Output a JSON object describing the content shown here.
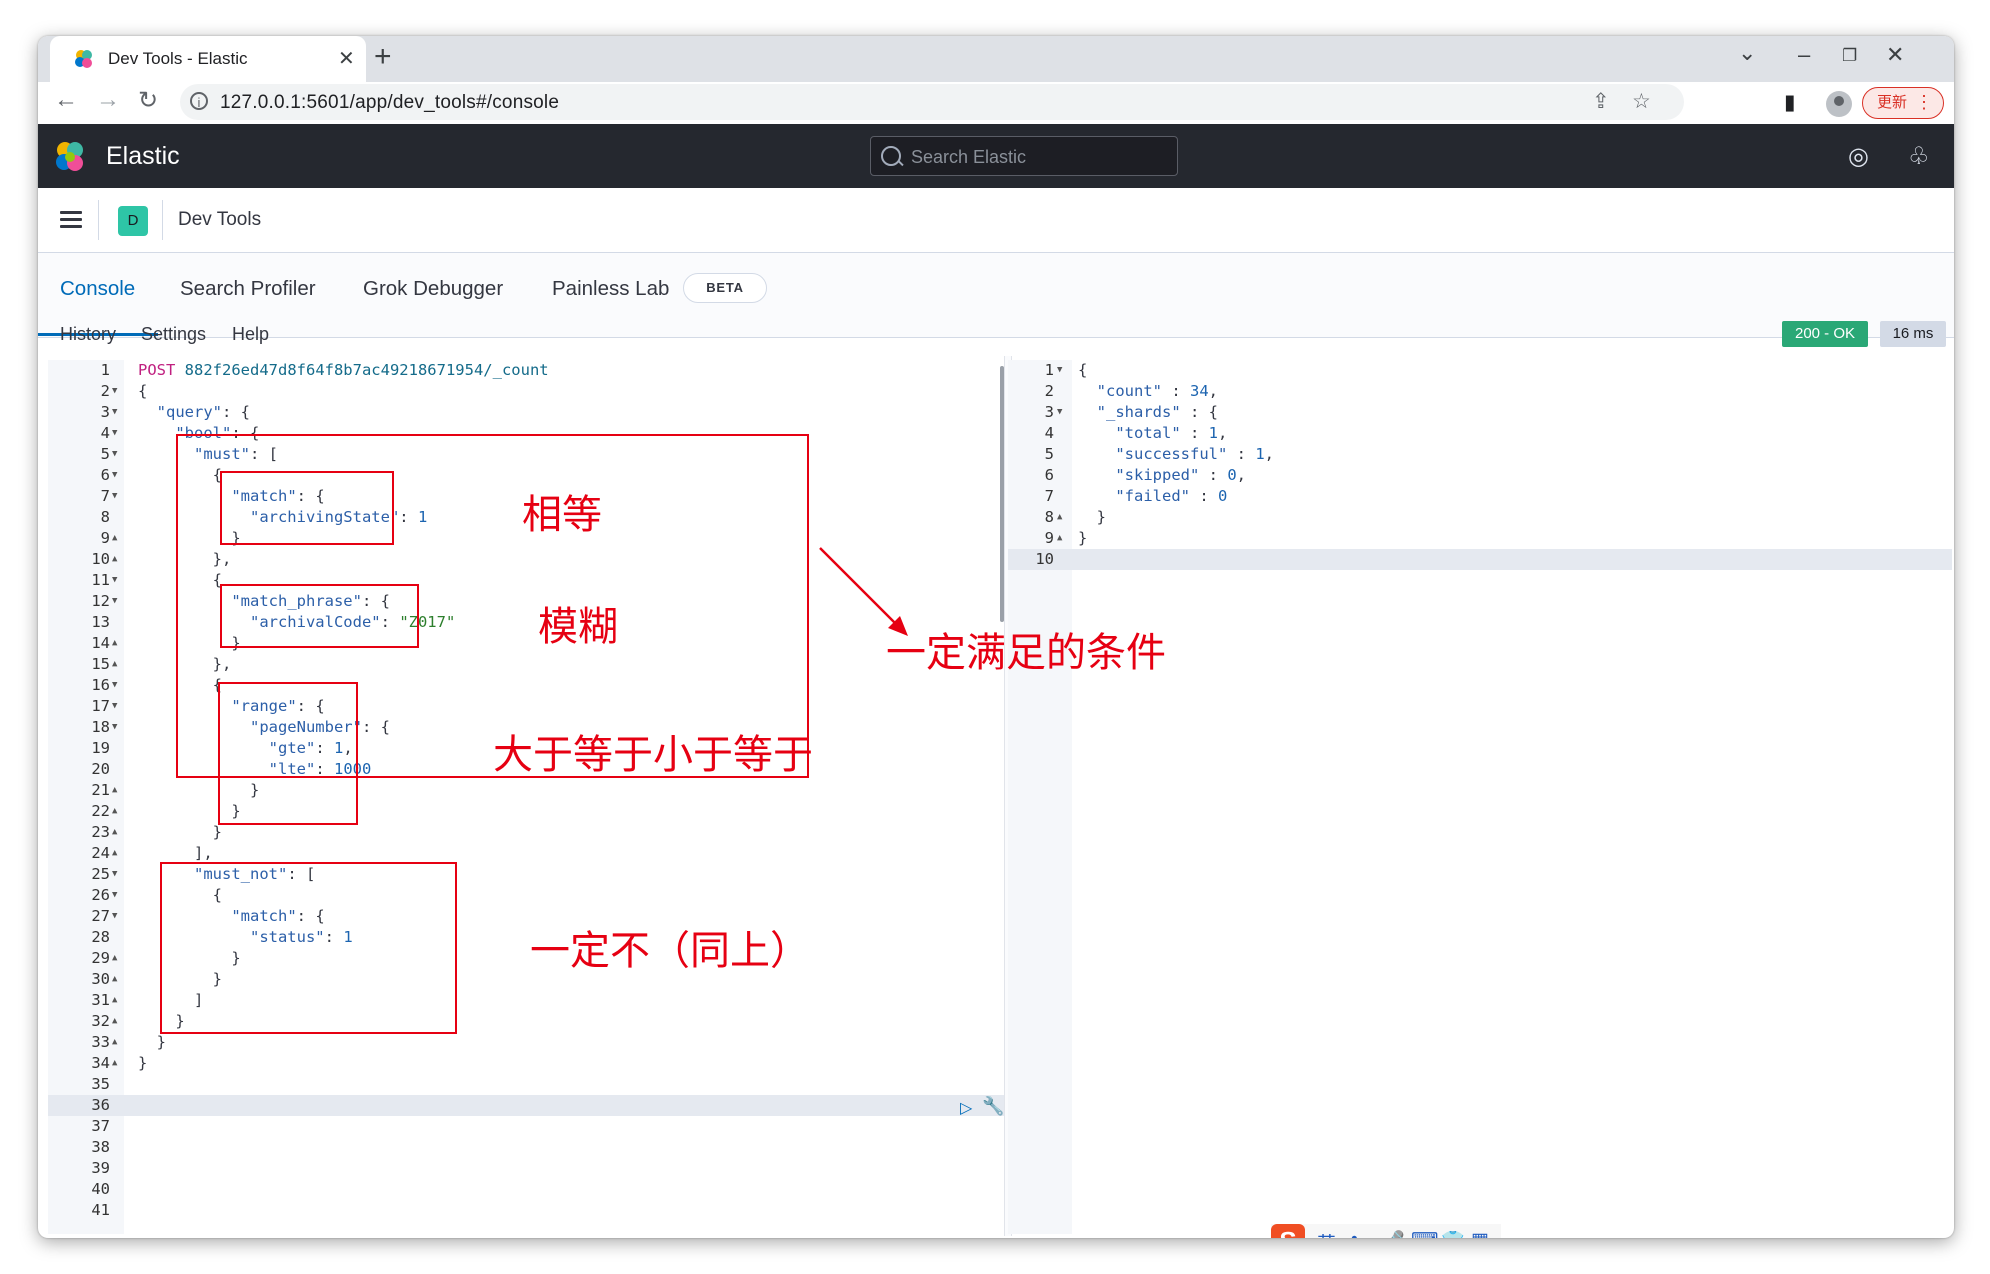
{
  "browser": {
    "tab_title": "Dev Tools - Elastic",
    "url": "127.0.0.1:5601/app/dev_tools#/console",
    "update_label": "更新"
  },
  "header": {
    "brand": "Elastic",
    "search_placeholder": "Search Elastic"
  },
  "breadcrumb": {
    "space_initial": "D",
    "title": "Dev Tools"
  },
  "tabs": [
    {
      "label": "Console",
      "active": true
    },
    {
      "label": "Search Profiler",
      "active": false
    },
    {
      "label": "Grok Debugger",
      "active": false
    },
    {
      "label": "Painless Lab",
      "active": false
    }
  ],
  "beta_badge": "BETA",
  "console_menu": [
    "History",
    "Settings",
    "Help"
  ],
  "status": {
    "code": "200 - OK",
    "time": "16 ms",
    "color": "#2aa876"
  },
  "request": {
    "method": "POST",
    "path": "882f26ed47d8f64f8b7ac49218671954/_count",
    "lines": [
      {
        "n": "1",
        "fold": "",
        "text": "POST 882f26ed47d8f64f8b7ac49218671954/_count"
      },
      {
        "n": "2",
        "fold": "down",
        "text": "{"
      },
      {
        "n": "3",
        "fold": "down",
        "text": "  \"query\": {"
      },
      {
        "n": "4",
        "fold": "down",
        "text": "    \"bool\": {"
      },
      {
        "n": "5",
        "fold": "down",
        "text": "      \"must\": ["
      },
      {
        "n": "6",
        "fold": "down",
        "text": "        {"
      },
      {
        "n": "7",
        "fold": "down",
        "text": "          \"match\": {"
      },
      {
        "n": "8",
        "fold": "",
        "text": "            \"archivingState\": 1"
      },
      {
        "n": "9",
        "fold": "up",
        "text": "          }"
      },
      {
        "n": "10",
        "fold": "up",
        "text": "        },"
      },
      {
        "n": "11",
        "fold": "down",
        "text": "        {"
      },
      {
        "n": "12",
        "fold": "down",
        "text": "          \"match_phrase\": {"
      },
      {
        "n": "13",
        "fold": "",
        "text": "            \"archivalCode\": \"Z017\""
      },
      {
        "n": "14",
        "fold": "up",
        "text": "          }"
      },
      {
        "n": "15",
        "fold": "up",
        "text": "        },"
      },
      {
        "n": "16",
        "fold": "down",
        "text": "        {"
      },
      {
        "n": "17",
        "fold": "down",
        "text": "          \"range\": {"
      },
      {
        "n": "18",
        "fold": "down",
        "text": "            \"pageNumber\": {"
      },
      {
        "n": "19",
        "fold": "",
        "text": "              \"gte\": 1,"
      },
      {
        "n": "20",
        "fold": "",
        "text": "              \"lte\": 1000"
      },
      {
        "n": "21",
        "fold": "up",
        "text": "            }"
      },
      {
        "n": "22",
        "fold": "up",
        "text": "          }"
      },
      {
        "n": "23",
        "fold": "up",
        "text": "        }"
      },
      {
        "n": "24",
        "fold": "up",
        "text": "      ],"
      },
      {
        "n": "25",
        "fold": "down",
        "text": "      \"must_not\": ["
      },
      {
        "n": "26",
        "fold": "down",
        "text": "        {"
      },
      {
        "n": "27",
        "fold": "down",
        "text": "          \"match\": {"
      },
      {
        "n": "28",
        "fold": "",
        "text": "            \"status\": 1"
      },
      {
        "n": "29",
        "fold": "up",
        "text": "          }"
      },
      {
        "n": "30",
        "fold": "up",
        "text": "        }"
      },
      {
        "n": "31",
        "fold": "up",
        "text": "      ]"
      },
      {
        "n": "32",
        "fold": "up",
        "text": "    }"
      },
      {
        "n": "33",
        "fold": "up",
        "text": "  }"
      },
      {
        "n": "34",
        "fold": "up",
        "text": "}"
      },
      {
        "n": "35",
        "fold": "",
        "text": ""
      },
      {
        "n": "36",
        "fold": "",
        "text": ""
      },
      {
        "n": "37",
        "fold": "",
        "text": ""
      },
      {
        "n": "38",
        "fold": "",
        "text": ""
      },
      {
        "n": "39",
        "fold": "",
        "text": ""
      },
      {
        "n": "40",
        "fold": "",
        "text": ""
      },
      {
        "n": "41",
        "fold": "",
        "text": ""
      }
    ]
  },
  "response": {
    "lines": [
      {
        "n": "1",
        "fold": "down",
        "text": "{"
      },
      {
        "n": "2",
        "fold": "",
        "text": "  \"count\" : 34,"
      },
      {
        "n": "3",
        "fold": "down",
        "text": "  \"_shards\" : {"
      },
      {
        "n": "4",
        "fold": "",
        "text": "    \"total\" : 1,"
      },
      {
        "n": "5",
        "fold": "",
        "text": "    \"successful\" : 1,"
      },
      {
        "n": "6",
        "fold": "",
        "text": "    \"skipped\" : 0,"
      },
      {
        "n": "7",
        "fold": "",
        "text": "    \"failed\" : 0"
      },
      {
        "n": "8",
        "fold": "up",
        "text": "  }"
      },
      {
        "n": "9",
        "fold": "up",
        "text": "}"
      },
      {
        "n": "10",
        "fold": "",
        "text": ""
      }
    ]
  },
  "annotations": {
    "equal": "相等",
    "fuzzy": "模糊",
    "range": "大于等于小于等于",
    "must": "一定满足的条件",
    "must_not": "一定不（同上）",
    "color": "#e60012"
  },
  "ime": {
    "logo": "S",
    "items": [
      "英",
      "•,",
      "🎤",
      "⌨",
      "👕",
      "▦"
    ]
  }
}
